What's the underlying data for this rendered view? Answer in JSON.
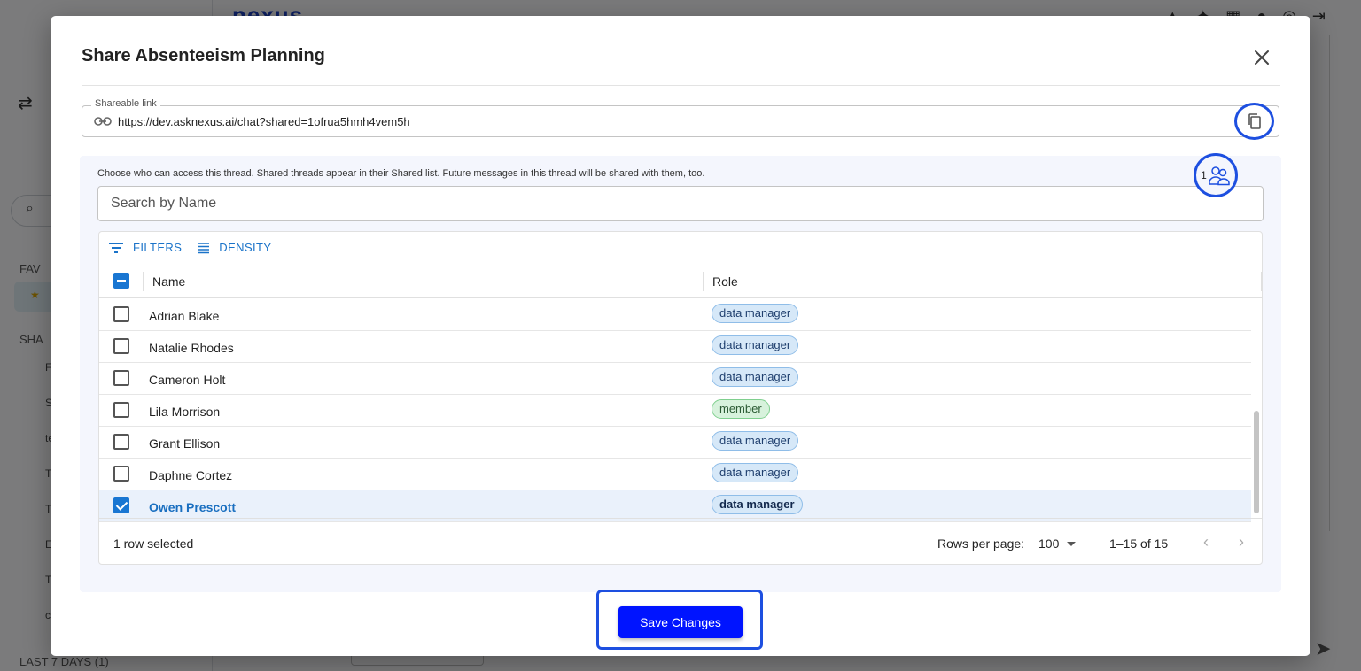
{
  "background": {
    "logo": "nexus",
    "sidebar_sections": [
      "FAV",
      "SHA"
    ],
    "sidebar_letters": [
      "F",
      "S",
      "te",
      "T",
      "T",
      "E",
      "T",
      "c"
    ],
    "bottom_section": "LAST 7 DAYS (1)"
  },
  "modal": {
    "title": "Share Absenteeism Planning",
    "close_label": "✕"
  },
  "link": {
    "legend": "Shareable link",
    "url": "https://dev.asknexus.ai/chat?shared=1ofrua5hmh4vem5h"
  },
  "share": {
    "help_text": "Choose who can access this thread. Shared threads appear in their Shared list. Future messages in this thread will be shared with them, too.",
    "selected_users_count": "1",
    "search_placeholder": "Search by Name"
  },
  "grid": {
    "toolbar": {
      "filters_label": "FILTERS",
      "density_label": "DENSITY"
    },
    "columns": {
      "name": "Name",
      "role": "Role"
    },
    "rows": [
      {
        "name": "Adrian Blake",
        "role": "data manager",
        "selected": false
      },
      {
        "name": "Natalie Rhodes",
        "role": "data manager",
        "selected": false
      },
      {
        "name": "Cameron Holt",
        "role": "data manager",
        "selected": false
      },
      {
        "name": "Lila Morrison",
        "role": "member",
        "selected": false
      },
      {
        "name": "Grant Ellison",
        "role": "data manager",
        "selected": false
      },
      {
        "name": "Daphne Cortez",
        "role": "data manager",
        "selected": false
      },
      {
        "name": "Owen Prescott",
        "role": "data manager",
        "selected": true
      }
    ],
    "footer": {
      "selected_text": "1 row selected",
      "rows_per_page_label": "Rows per page:",
      "rows_per_page_value": "100",
      "range_text": "1–15 of 15",
      "prev_label": "‹",
      "next_label": "›"
    }
  },
  "actions": {
    "save_label": "Save Changes"
  },
  "colors": {
    "accent": "#1976d2",
    "highlight_ring": "#1d4fe0",
    "save_button": "#0014ff",
    "chip_data_manager": "#d6e8f8",
    "chip_member": "#d7f2dc"
  }
}
